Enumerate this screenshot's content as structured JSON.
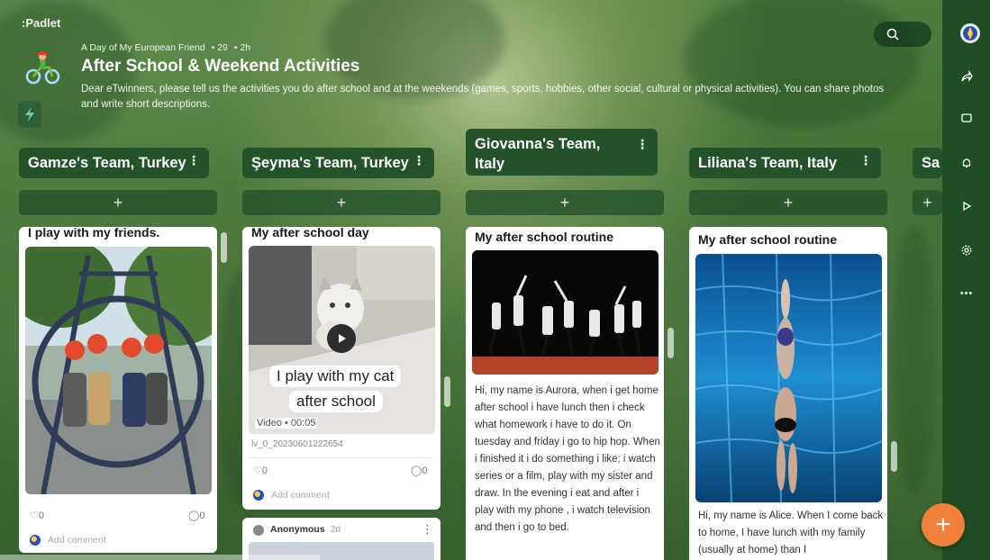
{
  "app": {
    "brand": ":Padlet"
  },
  "header": {
    "crumb": [
      "A Day of My European Friend",
      "• 29",
      "• 2h"
    ],
    "title": "After School & Weekend Activities",
    "description": "Dear eTwinners, please tell us the activities you do after school and at the weekends (games, sports, hobbies, other social, cultural or physical activities). You can share photos and write short descriptions."
  },
  "rail": {
    "icons": [
      "share-icon",
      "slideshow-icon",
      "bell-icon",
      "play-icon",
      "settings-icon",
      "more-icon"
    ],
    "more": "•••"
  },
  "columns": [
    {
      "name": "Gamze's Team, Turkey",
      "add": "+"
    },
    {
      "name": "Şeyma's Team, Turkey",
      "add": "+"
    },
    {
      "name": "Giovanna's Team, Italy",
      "add": "+"
    },
    {
      "name": "Liliana's Team, Italy",
      "add": "+"
    },
    {
      "name": "Sa",
      "add": "+"
    }
  ],
  "cards": {
    "c1": {
      "title": "I play with my friends.",
      "likes": "0",
      "comments": "0",
      "add_comment": "Add comment"
    },
    "c2": {
      "title": "My after school day",
      "overlay_line1": "I play with my cat",
      "overlay_line2": "after school",
      "video_meta": "Video • 00:05",
      "filename": "lv_0_20230601222654",
      "likes": "0",
      "comments": "0",
      "add_comment": "Add comment"
    },
    "c2b": {
      "author": "Anonymous",
      "time": "2d"
    },
    "c3": {
      "title": "My after school routine",
      "text": "Hi, my name is Aurora, when i get home after school i have lunch then i check what  homework i have to do it. On tuesday and friday i go to hip hop. When i finished it i do something i like; i watch series or a film, play with my sister and draw. In the evening i eat and after i play with my phone , i watch television and then i go to bed."
    },
    "c4": {
      "title": "My after school routine",
      "text": "Hi, my name is Alice. When I come back to home, I have  lunch with my family (usually at home) than I"
    }
  },
  "fab": {
    "label": "+"
  }
}
